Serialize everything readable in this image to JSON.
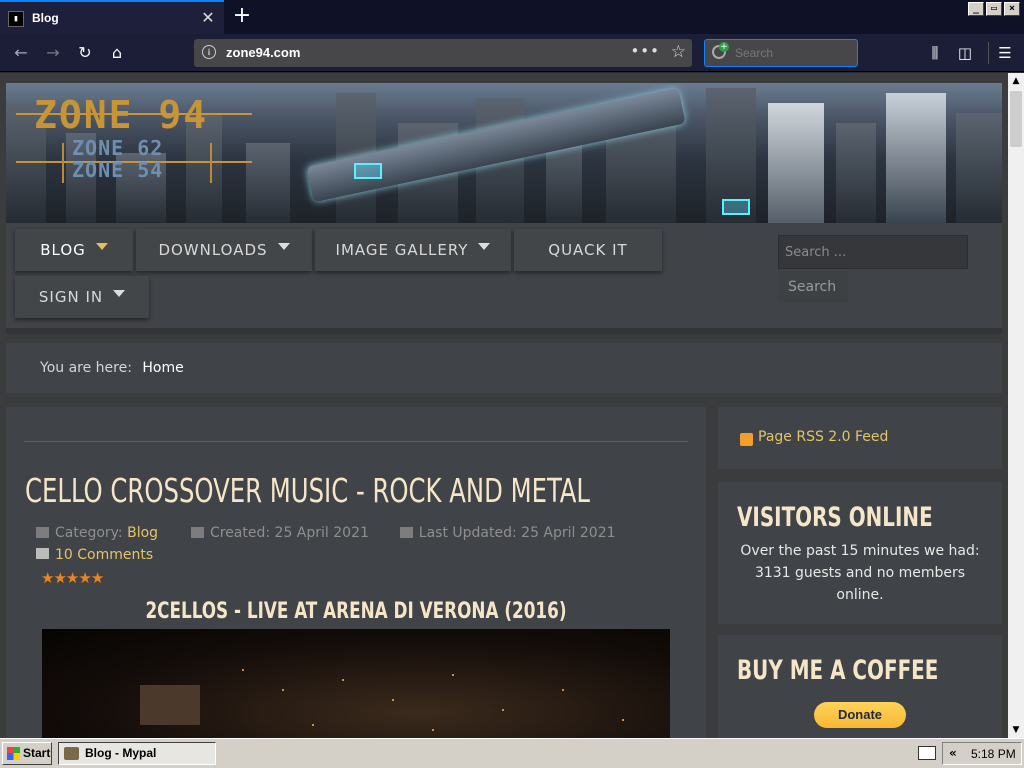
{
  "browser": {
    "tab_title": "Blog",
    "tab_favicon": "terminal-icon",
    "url": "zone94.com",
    "search_placeholder": "Search",
    "window_buttons": [
      "_",
      "▭",
      "×"
    ]
  },
  "site": {
    "logo_main": "ZONE 94",
    "logo_sub1": "ZONE 62",
    "logo_sub2": "ZONE 54",
    "menu": [
      {
        "label": "BLOG",
        "has_dropdown": true,
        "active": true
      },
      {
        "label": "DOWNLOADS",
        "has_dropdown": true,
        "active": false
      },
      {
        "label": "IMAGE GALLERY",
        "has_dropdown": true,
        "active": false
      },
      {
        "label": "QUACK IT",
        "has_dropdown": false,
        "active": false
      },
      {
        "label": "SIGN IN",
        "has_dropdown": true,
        "active": false
      }
    ],
    "search_placeholder": "Search ...",
    "search_button": "Search",
    "breadcrumb_prefix": "You are here:",
    "breadcrumb_home": "Home"
  },
  "article": {
    "title": "CELLO CROSSOVER MUSIC - ROCK AND METAL",
    "category_label": "Category:",
    "category": "Blog",
    "created": "Created: 25 April 2021",
    "updated": "Last Updated: 25 April 2021",
    "comments": "10 Comments",
    "rating_stars": 5,
    "subtitle": "2CELLOS - LIVE AT ARENA DI VERONA (2016)"
  },
  "sidebar": {
    "rss": "Page RSS 2.0 Feed",
    "visitors_title": "VISITORS ONLINE",
    "visitors_text": "Over the past 15 minutes we had: 3131 guests and no members online.",
    "coffee_title": "BUY ME A COFFEE",
    "donate": "Donate"
  },
  "taskbar": {
    "start": "Start",
    "task": "Blog - Mypal",
    "tray_arrows": "«",
    "time": "5:18 PM"
  },
  "colors": {
    "accent_gold": "#e3c566",
    "title_cream": "#f5e6c8",
    "star_orange": "#f0841c",
    "browser_dark": "#1c1d36",
    "focus_blue": "#0a84ff"
  }
}
